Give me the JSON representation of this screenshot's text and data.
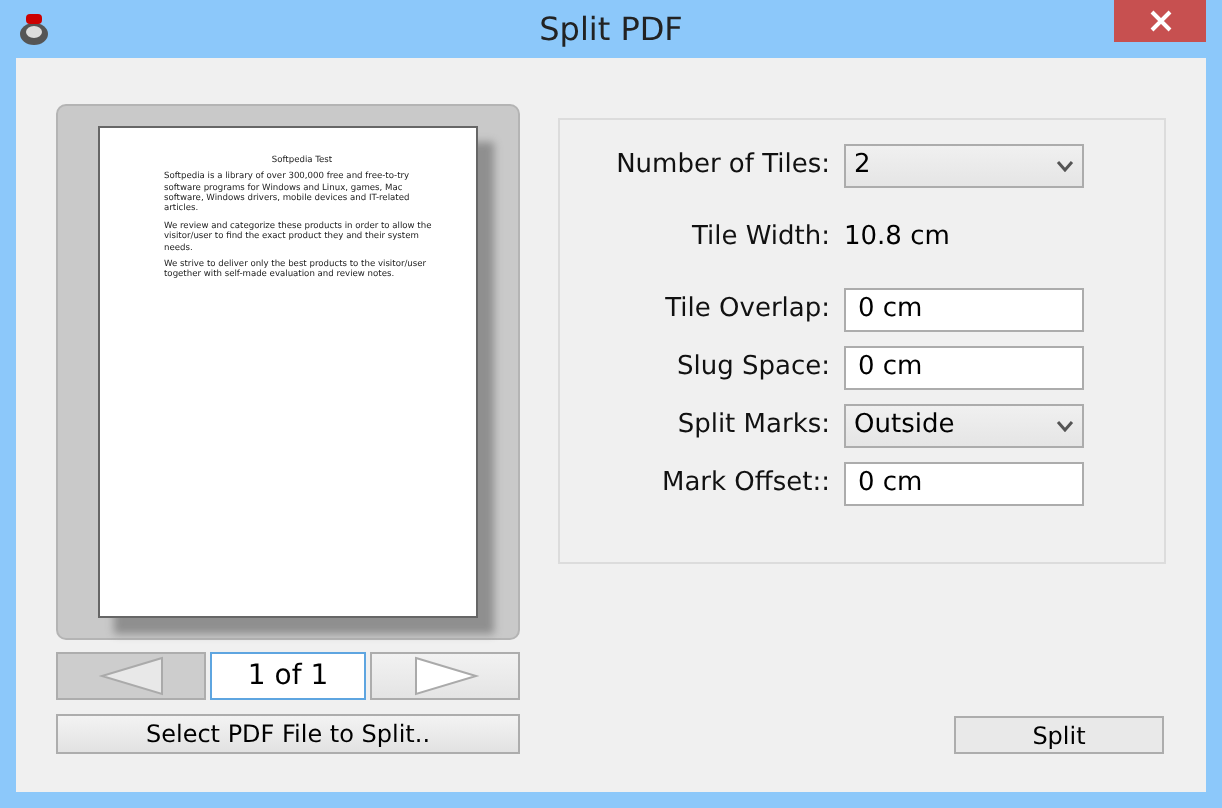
{
  "window": {
    "title": "Split PDF"
  },
  "preview": {
    "page": {
      "heading": "Softpedia Test",
      "paragraphs": [
        "Softpedia is a library of over 300,000 free and free-to-try software programs for Windows and Linux, games, Mac software, Windows drivers, mobile devices and IT-related articles.",
        "We review and categorize these products in order to allow the visitor/user to find the exact product they and their system needs.",
        "We strive to deliver only the best products to the visitor/user together with self-made evaluation and review notes."
      ]
    },
    "prev_disabled": true,
    "next_disabled": false,
    "page_indicator": "1 of 1"
  },
  "select_button": "Select PDF File to Split..",
  "settings": [
    {
      "kind": "select",
      "label": "Number of Tiles:",
      "value": "2"
    },
    {
      "kind": "text",
      "label": "Tile Width:",
      "value": "10.8 cm"
    },
    {
      "kind": "input",
      "label": "Tile Overlap:",
      "value": "0 cm"
    },
    {
      "kind": "input",
      "label": "Slug Space:",
      "value": "0 cm"
    },
    {
      "kind": "select",
      "label": "Split Marks:",
      "value": "Outside"
    },
    {
      "kind": "input",
      "label": "Mark Offset::",
      "value": "0 cm"
    }
  ],
  "split_button": "Split"
}
